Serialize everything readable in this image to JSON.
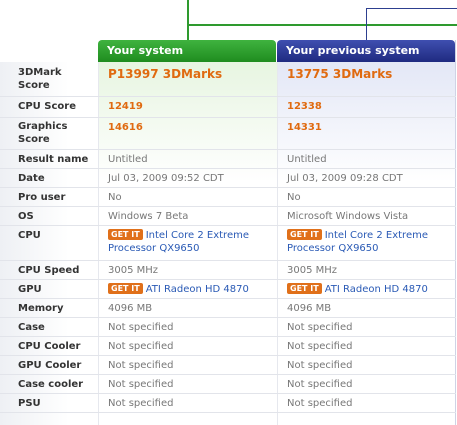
{
  "headers": {
    "current": "Your system",
    "previous": "Your previous system"
  },
  "rows": {
    "score": {
      "label": "3DMark Score",
      "current": "P13997 3DMarks",
      "previous": "13775 3DMarks"
    },
    "cpu_score": {
      "label": "CPU Score",
      "current": "12419",
      "previous": "12338"
    },
    "gfx_score": {
      "label": "Graphics Score",
      "current": "14616",
      "previous": "14331"
    },
    "result_name": {
      "label": "Result name",
      "current": "Untitled",
      "previous": "Untitled"
    },
    "date": {
      "label": "Date",
      "current": "Jul 03, 2009 09:52 CDT",
      "previous": "Jul 03, 2009 09:28 CDT"
    },
    "pro_user": {
      "label": "Pro user",
      "current": "No",
      "previous": "No"
    },
    "os": {
      "label": "OS",
      "current": "Windows 7 Beta",
      "previous": "Microsoft Windows Vista"
    },
    "cpu": {
      "label": "CPU",
      "current": "Intel Core 2 Extreme Processor QX9650",
      "previous": "Intel Core 2 Extreme Processor QX9650"
    },
    "cpu_speed": {
      "label": "CPU Speed",
      "current": "3005 MHz",
      "previous": "3005 MHz"
    },
    "gpu": {
      "label": "GPU",
      "current": "ATI Radeon HD 4870",
      "previous": "ATI Radeon HD 4870"
    },
    "memory": {
      "label": "Memory",
      "current": "4096 MB",
      "previous": "4096 MB"
    },
    "case": {
      "label": "Case",
      "current": "Not specified",
      "previous": "Not specified"
    },
    "cpu_cooler": {
      "label": "CPU Cooler",
      "current": "Not specified",
      "previous": "Not specified"
    },
    "gpu_cooler": {
      "label": "GPU Cooler",
      "current": "Not specified",
      "previous": "Not specified"
    },
    "case_cooler": {
      "label": "Case cooler",
      "current": "Not specified",
      "previous": "Not specified"
    },
    "psu": {
      "label": "PSU",
      "current": "Not specified",
      "previous": "Not specified"
    }
  },
  "getit_label": "GET IT",
  "colors": {
    "current_header": "#2e9a2e",
    "previous_header": "#2d3f8f",
    "score": "#e06a10",
    "link": "#2a5ab5",
    "getit": "#e0701a"
  }
}
